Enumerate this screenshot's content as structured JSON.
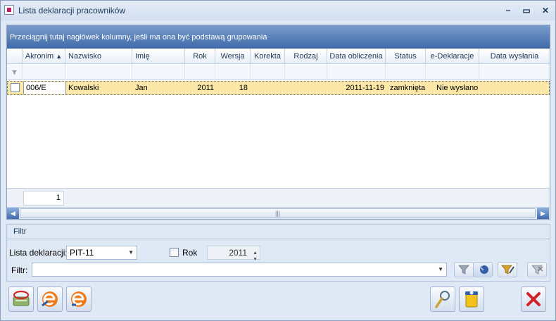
{
  "window": {
    "title": "Lista deklaracji pracowników",
    "controls": [
      "minimize-icon",
      "maximize-icon",
      "close-icon"
    ]
  },
  "grid": {
    "group_panel_text": "Przeciągnij tutaj nagłówek kolumny, jeśli ma ona być podstawą grupowania",
    "columns": [
      "Akronim",
      "Nazwisko",
      "Imię",
      "Rok",
      "Wersja",
      "Korekta",
      "Rodzaj",
      "Data obliczenia",
      "Status",
      "e-Deklaracje",
      "Data wysłania"
    ],
    "sort_indicator": "▲",
    "rows": [
      {
        "akronim": "006/E",
        "nazwisko": "Kowalski",
        "imie": "Jan",
        "rok": "2011",
        "wersja": "18",
        "korekta": "",
        "rodzaj": "",
        "data_obliczenia": "2011-11-19",
        "status": "zamknięta",
        "e_deklaracje": "Nie wysłano",
        "data_wyslania": ""
      }
    ],
    "record_count": "1"
  },
  "filter": {
    "group_title": "Filtr",
    "lista_label": "Lista deklaracji:",
    "lista_value": "PIT-11",
    "rok_label": "Rok",
    "rok_checked": false,
    "rok_value": "2011",
    "filtr_label": "Filtr:",
    "filtr_value": ""
  },
  "colors": {
    "accent": "#3f6aa8",
    "selected_row": "#fbe8a8",
    "cancel": "#d2202a"
  }
}
